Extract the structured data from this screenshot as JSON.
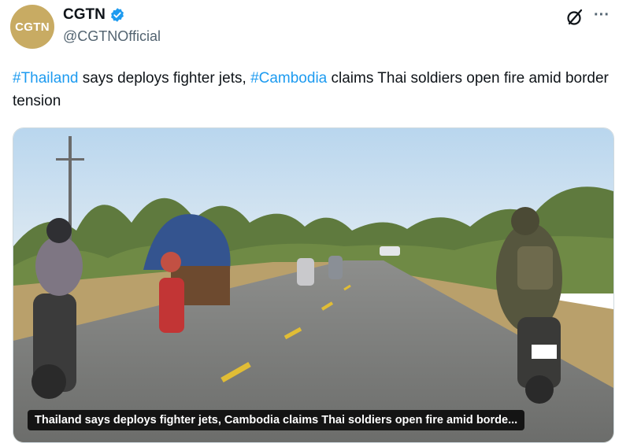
{
  "tweet": {
    "avatar_text": "CGTN",
    "display_name": "CGTN",
    "handle": "@CGTNOfficial",
    "verified": true,
    "text": {
      "hashtag1": "#Thailand",
      "part1": " says deploys fighter jets, ",
      "hashtag2": "#Cambodia",
      "part2": " claims Thai soldiers open fire amid border tension"
    },
    "media": {
      "caption": "Thailand says deploys fighter jets, Cambodia claims Thai soldiers open fire amid borde..."
    }
  },
  "icons": {
    "verified": "verified-badge-icon",
    "grok": "grok-icon",
    "more": "more-options-icon"
  },
  "colors": {
    "accent": "#1d9bf0",
    "avatar_bg": "#c8ab63",
    "text": "#0f1419",
    "secondary_text": "#536471"
  }
}
